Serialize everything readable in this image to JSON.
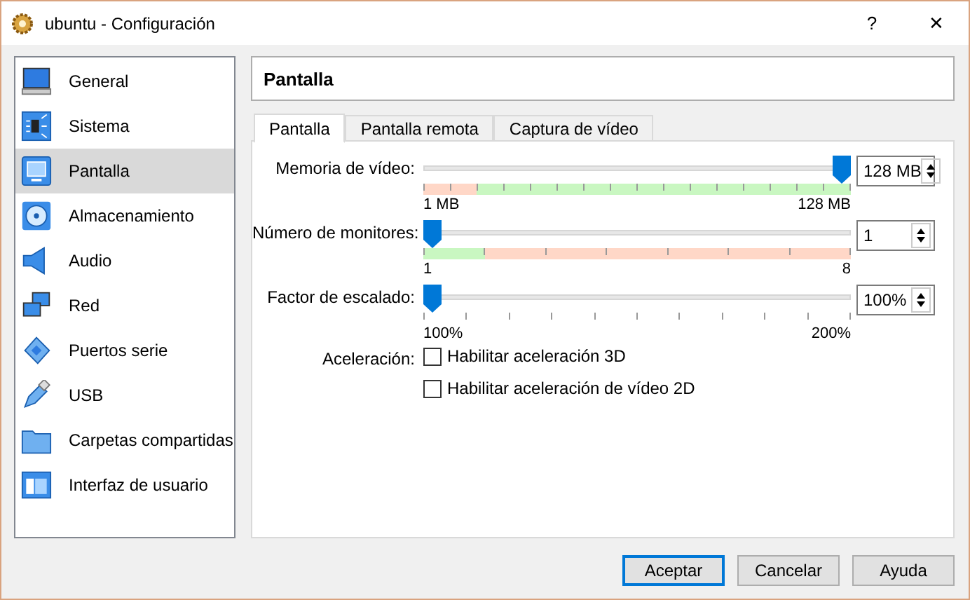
{
  "window": {
    "title": "ubuntu - Configuración",
    "buttons": [
      "?",
      "✕"
    ]
  },
  "sidebar": {
    "items": [
      {
        "label": "General",
        "selected": false
      },
      {
        "label": "Sistema",
        "selected": false
      },
      {
        "label": "Pantalla",
        "selected": true
      },
      {
        "label": "Almacenamiento",
        "selected": false
      },
      {
        "label": "Audio",
        "selected": false
      },
      {
        "label": "Red",
        "selected": false
      },
      {
        "label": "Puertos serie",
        "selected": false
      },
      {
        "label": "USB",
        "selected": false
      },
      {
        "label": "Carpetas compartidas",
        "selected": false
      },
      {
        "label": "Interfaz de usuario",
        "selected": false
      }
    ]
  },
  "page_title": "Pantalla",
  "tabs": [
    {
      "label": "Pantalla",
      "selected": true
    },
    {
      "label": "Pantalla remota",
      "selected": false
    },
    {
      "label": "Captura de vídeo",
      "selected": false
    }
  ],
  "sliders": [
    {
      "label": "Memoria de vídeo:",
      "level": 1,
      "value": "128 MB",
      "min_label": "1 MB",
      "max_label": "128 MB",
      "zone": {
        "kind": "bad_first",
        "level": 0.125
      }
    },
    {
      "label": "Número de monitores:",
      "level": 0,
      "value": "1",
      "min_label": "1",
      "max_label": "8",
      "zone": {
        "kind": "good_first",
        "level": 0.143
      }
    },
    {
      "label": "Factor de escalado:",
      "level": 0,
      "value": "100%",
      "min_label": "100%",
      "max_label": "200%"
    }
  ],
  "acceleration": {
    "label": "Aceleración:",
    "options": [
      {
        "label": "Habilitar aceleración 3D",
        "checked": false
      },
      {
        "label": "Habilitar aceleración de vídeo 2D",
        "checked": false
      }
    ]
  },
  "buttons": [
    {
      "label": "Aceptar",
      "default": true
    },
    {
      "label": "Cancelar",
      "default": false
    },
    {
      "label": "Ayuda",
      "default": false
    }
  ]
}
